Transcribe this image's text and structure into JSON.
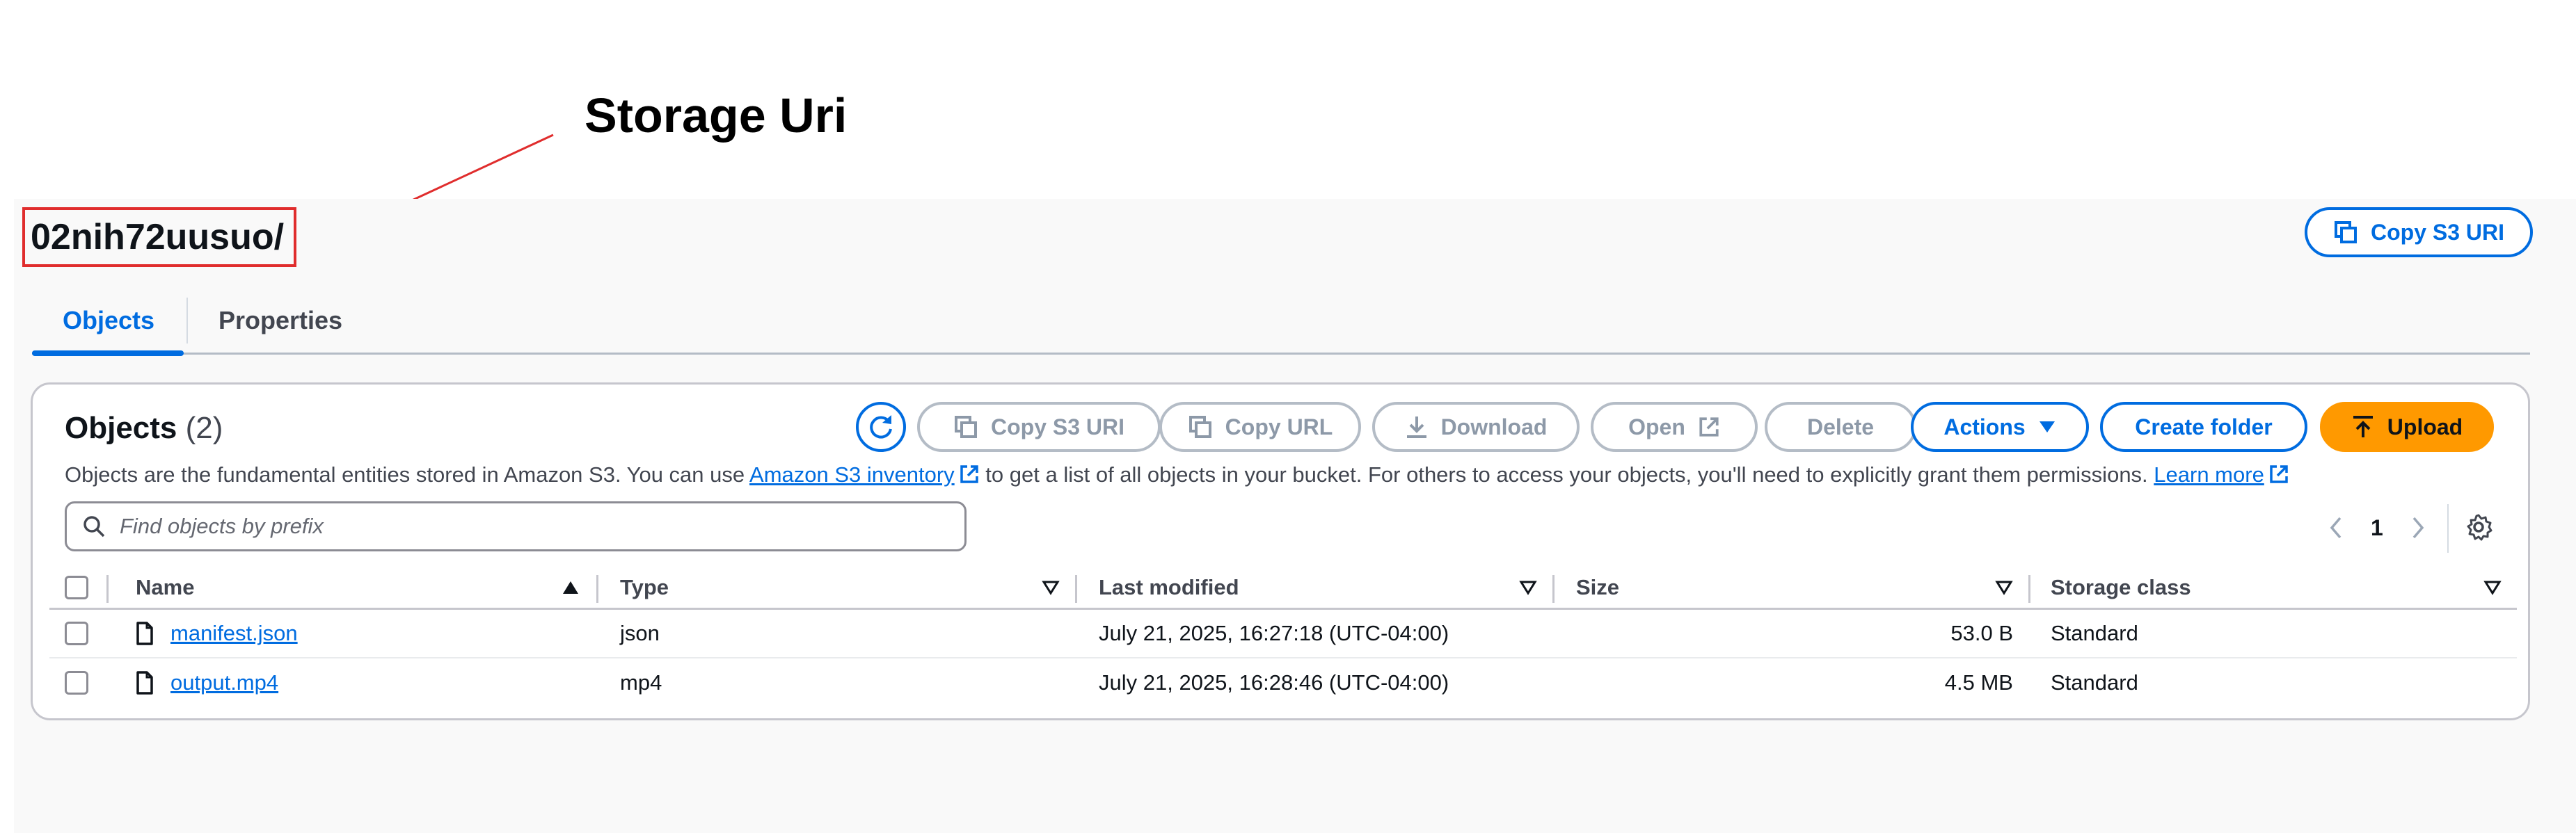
{
  "annotation": {
    "label": "Storage Uri"
  },
  "header": {
    "prefix_title": "02nih72uusuo/",
    "copy_s3_uri_label": "Copy S3 URI"
  },
  "tabs": [
    {
      "label": "Objects",
      "active": true
    },
    {
      "label": "Properties",
      "active": false
    }
  ],
  "objects_panel": {
    "title": "Objects",
    "count": "(2)",
    "description_before": "Objects are the fundamental entities stored in Amazon S3. You can use ",
    "inventory_link": "Amazon S3 inventory",
    "description_middle": " to get a list of all objects in your bucket. For others to access your objects, you'll need to explicitly grant them permissions. ",
    "learn_more_link": "Learn more",
    "toolbar": {
      "copy_s3_uri": "Copy S3 URI",
      "copy_url": "Copy URL",
      "download": "Download",
      "open": "Open",
      "delete": "Delete",
      "actions": "Actions",
      "create_folder": "Create folder",
      "upload": "Upload"
    },
    "search": {
      "placeholder": "Find objects by prefix",
      "value": ""
    },
    "pagination": {
      "current_page": "1"
    },
    "columns": [
      "Name",
      "Type",
      "Last modified",
      "Size",
      "Storage class"
    ],
    "rows": [
      {
        "name": "manifest.json",
        "type": "json",
        "last_modified": "July 21, 2025, 16:27:18 (UTC-04:00)",
        "size": "53.0 B",
        "storage_class": "Standard"
      },
      {
        "name": "output.mp4",
        "type": "mp4",
        "last_modified": "July 21, 2025, 16:28:46 (UTC-04:00)",
        "size": "4.5 MB",
        "storage_class": "Standard"
      }
    ]
  },
  "colors": {
    "accent": "#006ce0",
    "upload": "#ff9900",
    "annotation": "#e02d2d"
  },
  "icons": [
    "refresh-icon",
    "copy-icon",
    "download-icon",
    "external-link-icon",
    "caret-down-icon",
    "upload-arrow-icon",
    "search-icon",
    "chevron-left-icon",
    "chevron-right-icon",
    "settings-icon",
    "sort-asc-icon",
    "sort-desc-icon",
    "file-icon"
  ]
}
